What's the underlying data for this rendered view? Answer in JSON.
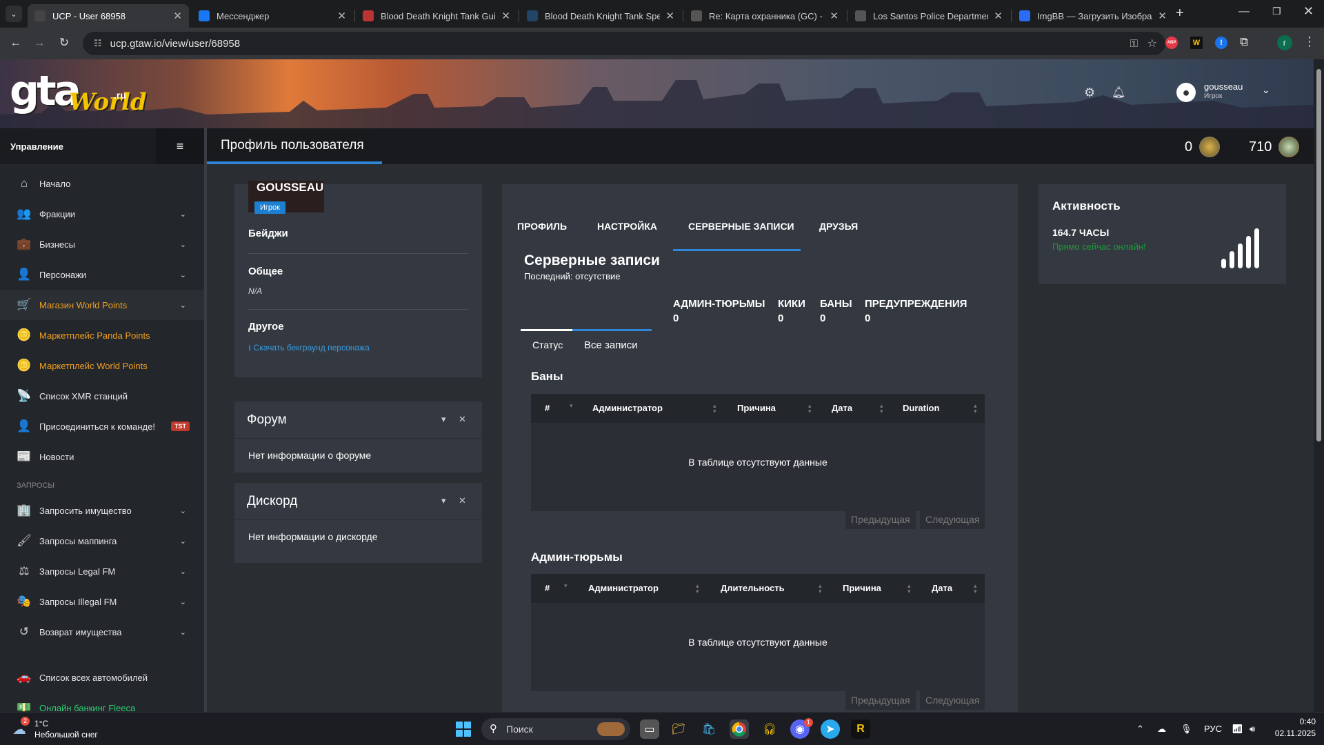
{
  "browser": {
    "tabs": [
      {
        "title": "UCP - User 68958",
        "active": true,
        "favicon_color": "#444"
      },
      {
        "title": "Мессенджер",
        "active": false,
        "favicon_color": "#1877f2"
      },
      {
        "title": "Blood Death Knight Tank Guide",
        "active": false,
        "favicon_color": "#b33"
      },
      {
        "title": "Blood Death Knight Tank Spell",
        "active": false,
        "favicon_color": "#246"
      },
      {
        "title": "Re: Карта охранника (GC) - Los",
        "active": false,
        "favicon_color": "#555"
      },
      {
        "title": "Los Santos Police Department",
        "active": false,
        "favicon_color": "#555"
      },
      {
        "title": "ImgBB — Загрузить Изображе",
        "active": false,
        "favicon_color": "#2a6df4"
      }
    ],
    "url": "ucp.gtaw.io/view/user/68958",
    "ext_badges": [
      "ABP",
      "W",
      "!"
    ],
    "profile_initial": "г"
  },
  "banner": {
    "logo_main": "gta",
    "logo_world": "World",
    "logo_ru": ".ru",
    "username": "gousseau",
    "role": "Игрок"
  },
  "sidebar": {
    "title": "Управление",
    "items": [
      {
        "label": "Начало",
        "icon": "home-icon",
        "glyph": "⌂",
        "chevron": false,
        "style": ""
      },
      {
        "label": "Фракции",
        "icon": "users-icon",
        "glyph": "👥",
        "chevron": true,
        "style": ""
      },
      {
        "label": "Бизнесы",
        "icon": "briefcase-icon",
        "glyph": "💼",
        "chevron": true,
        "style": ""
      },
      {
        "label": "Персонажи",
        "icon": "user-icon",
        "glyph": "👤",
        "chevron": true,
        "style": ""
      },
      {
        "label": "Магазин World Points",
        "icon": "cart-icon",
        "glyph": "🛒",
        "chevron": true,
        "style": "hl"
      },
      {
        "label": "Маркетплейс Panda Points",
        "icon": "coins-icon",
        "glyph": "🪙",
        "chevron": false,
        "style": "orange"
      },
      {
        "label": "Маркетплейс World Points",
        "icon": "coins-icon",
        "glyph": "🪙",
        "chevron": false,
        "style": "orange"
      },
      {
        "label": "Список XMR станций",
        "icon": "antenna-icon",
        "glyph": "📡",
        "chevron": false,
        "style": ""
      },
      {
        "label": "Присоединиться к команде!",
        "icon": "user-plus-icon",
        "glyph": "👤",
        "chevron": false,
        "style": "",
        "badge": "TST"
      },
      {
        "label": "Новости",
        "icon": "newspaper-icon",
        "glyph": "📰",
        "chevron": false,
        "style": ""
      }
    ],
    "section_label": "ЗАПРОСЫ",
    "requests": [
      {
        "label": "Запросить имущество",
        "icon": "building-icon",
        "glyph": "🏢",
        "chevron": true
      },
      {
        "label": "Запросы маппинга",
        "icon": "brush-icon",
        "glyph": "🖌",
        "chevron": true
      },
      {
        "label": "Запросы Legal FM",
        "icon": "scale-icon",
        "glyph": "⚖",
        "chevron": true
      },
      {
        "label": "Запросы Illegal FM",
        "icon": "mask-icon",
        "glyph": "🎭",
        "chevron": true
      },
      {
        "label": "Возврат имущества",
        "icon": "undo-icon",
        "glyph": "↺",
        "chevron": true
      }
    ],
    "bottom": [
      {
        "label": "Список всех автомобилей",
        "icon": "car-icon",
        "glyph": "🚗"
      },
      {
        "label": "Онлайн банкинг Fleeca",
        "icon": "money-icon",
        "glyph": "💵"
      }
    ]
  },
  "page": {
    "title": "Профиль пользователя",
    "panda_points": "0",
    "world_points": "710"
  },
  "profile": {
    "name": "GOUSSEAU",
    "role": "Игрок",
    "badges_label": "Бейджи",
    "general_label": "Общее",
    "general_value": "N/A",
    "other_label": "Другое",
    "download_link": "Скачать бекграунд персонажа"
  },
  "forum": {
    "title": "Форум",
    "body": "Нет информации о форуме"
  },
  "discord": {
    "title": "Дискорд",
    "body": "Нет информации о дискорде"
  },
  "tabs": [
    "ПРОФИЛЬ",
    "НАСТРОЙКА",
    "СЕРВЕРНЫЕ ЗАПИСИ",
    "ДРУЗЬЯ"
  ],
  "records": {
    "title": "Серверные записи",
    "last": "Последний: отсутствие",
    "stats": [
      {
        "label": "АДМИН-ТЮРЬМЫ",
        "value": "0"
      },
      {
        "label": "КИКИ",
        "value": "0"
      },
      {
        "label": "БАНЫ",
        "value": "0"
      },
      {
        "label": "ПРЕДУПРЕЖДЕНИЯ",
        "value": "0"
      }
    ],
    "subtabs": [
      "Статус",
      "Все записи"
    ],
    "bans": {
      "title": "Баны",
      "columns": [
        "#",
        "Администратор",
        "Причина",
        "Дата",
        "Duration"
      ],
      "empty": "В таблице отсутствуют данные",
      "prev": "Предыдущая",
      "next": "Следующая"
    },
    "jails": {
      "title": "Админ-тюрьмы",
      "columns": [
        "#",
        "Администратор",
        "Длительность",
        "Причина",
        "Дата"
      ],
      "empty": "В таблице отсутствуют данные",
      "prev": "Предыдущая",
      "next": "Следующая"
    }
  },
  "activity": {
    "title": "Активность",
    "hours": "164.7 ЧАСЫ",
    "status": "Прямо сейчас онлайн!",
    "status_color": "#1f9a3a",
    "signal_level": 5
  },
  "taskbar": {
    "weather_temp": "1°C",
    "weather_desc": "Небольшой снег",
    "weather_badge": "2",
    "search": "Поиск",
    "lang": "РУС",
    "time": "0:40",
    "date": "02.11.2025",
    "discord_badge": "1"
  }
}
